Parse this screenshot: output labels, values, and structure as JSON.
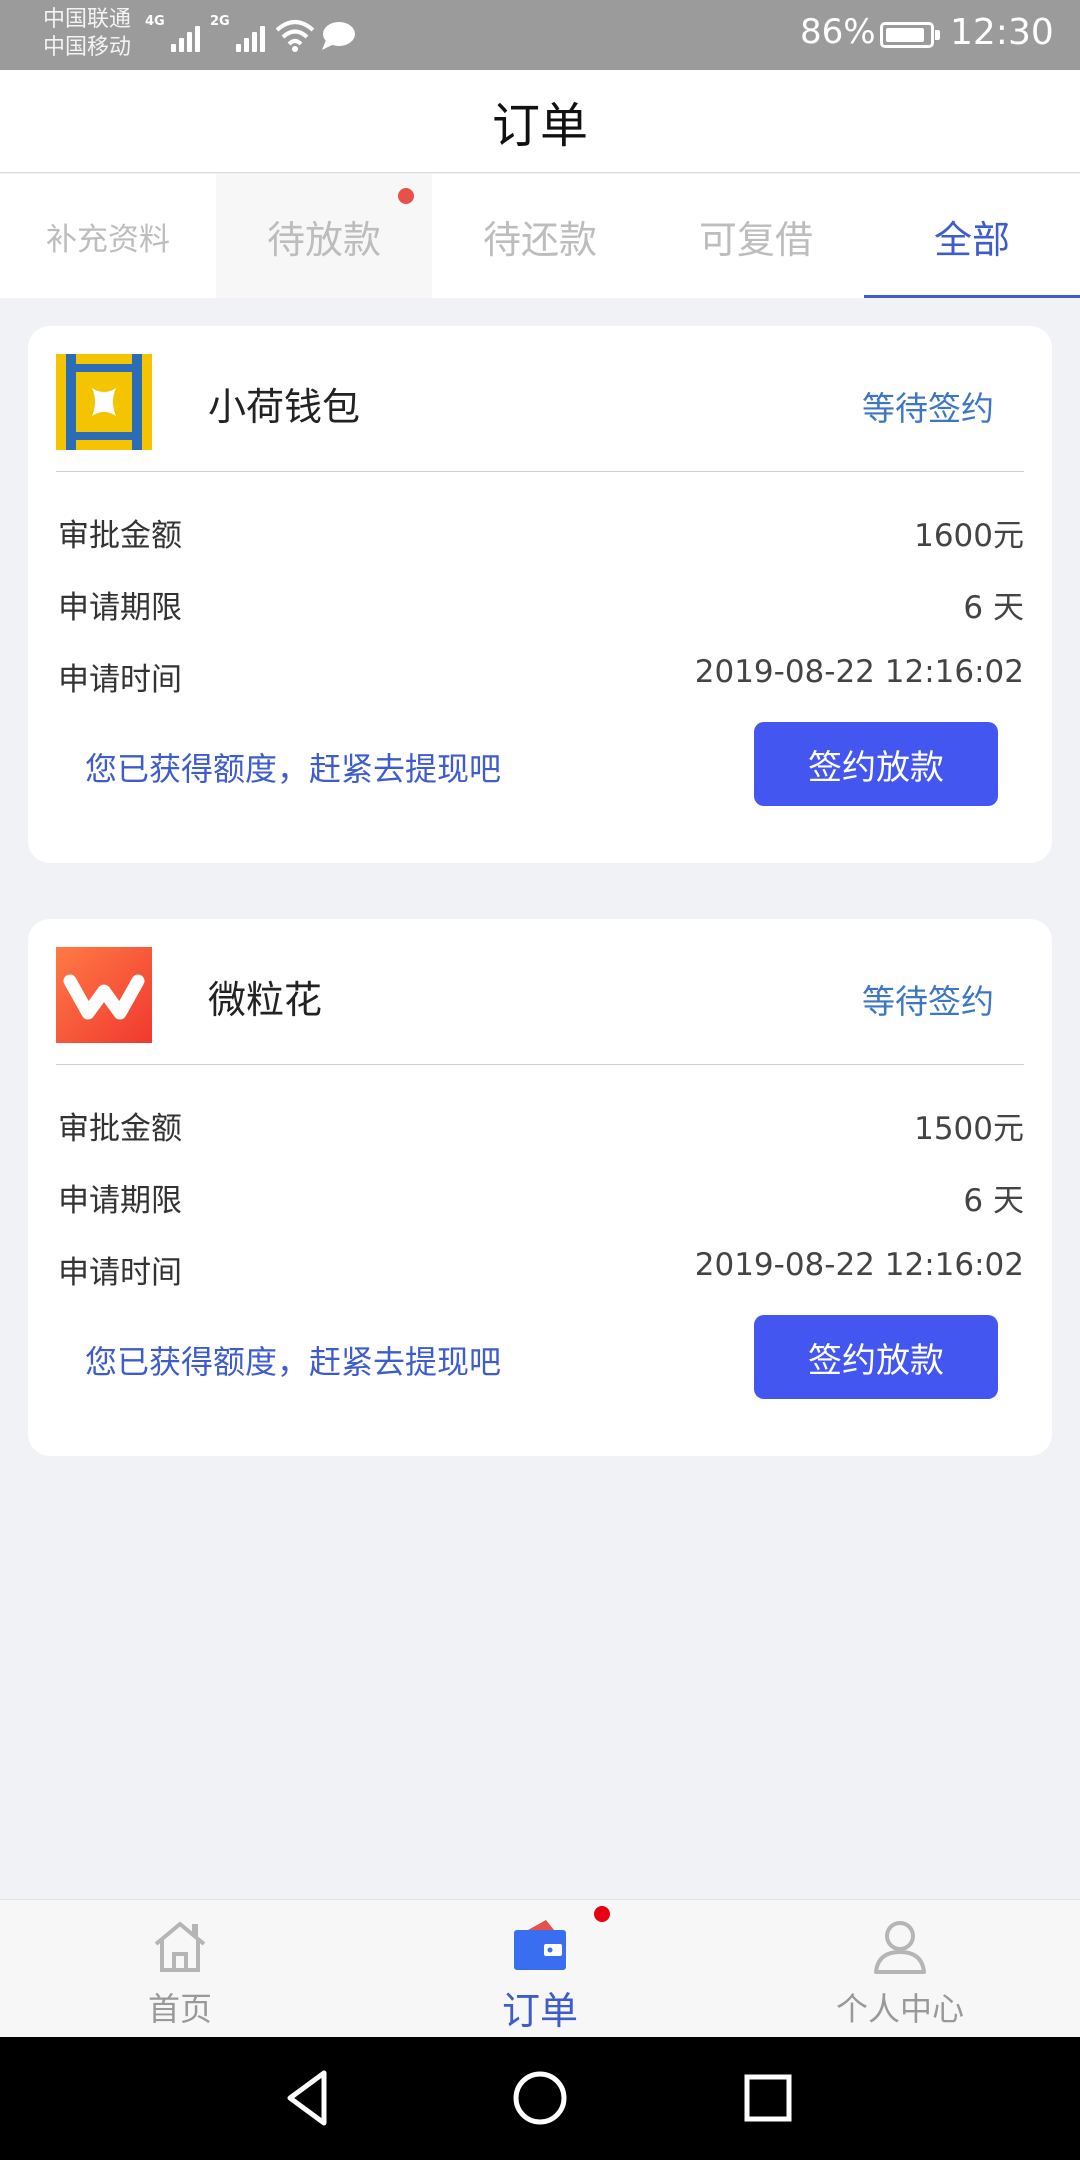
{
  "status_bar": {
    "carrier1": "中国联通",
    "carrier2": "中国移动",
    "sig1_tag": "4G",
    "sig2_tag": "2G",
    "battery": "86%",
    "time": "12:30"
  },
  "header": {
    "title": "订单"
  },
  "tabs": [
    {
      "label": "补充资料",
      "active": false,
      "badge": false
    },
    {
      "label": "待放款",
      "active": false,
      "badge": true
    },
    {
      "label": "待还款",
      "active": false,
      "badge": false
    },
    {
      "label": "可复借",
      "active": false,
      "badge": false
    },
    {
      "label": "全部",
      "active": true,
      "badge": false
    }
  ],
  "orders": [
    {
      "name": "小荷钱包",
      "logo_icon": "xiaohe-logo-icon",
      "status": "等待签约",
      "rows": [
        {
          "label": "审批金额",
          "value": "1600元"
        },
        {
          "label": "申请期限",
          "value": "6 天"
        },
        {
          "label": "申请时间",
          "value": "2019-08-22 12:16:02"
        }
      ],
      "tip": "您已获得额度，赶紧去提现吧",
      "button": "签约放款"
    },
    {
      "name": "微粒花",
      "logo_icon": "weilihua-logo-icon",
      "status": "等待签约",
      "rows": [
        {
          "label": "审批金额",
          "value": "1500元"
        },
        {
          "label": "申请期限",
          "value": "6 天"
        },
        {
          "label": "申请时间",
          "value": "2019-08-22 12:16:02"
        }
      ],
      "tip": "您已获得额度，赶紧去提现吧",
      "button": "签约放款"
    }
  ],
  "bottom_nav": [
    {
      "label": "首页",
      "icon": "home-icon",
      "active": false
    },
    {
      "label": "订单",
      "icon": "wallet-icon",
      "active": true
    },
    {
      "label": "个人中心",
      "icon": "user-icon",
      "active": false
    }
  ],
  "colors": {
    "accent": "#3e5ccc",
    "button": "#4356f0",
    "badge": "#e8514a"
  }
}
